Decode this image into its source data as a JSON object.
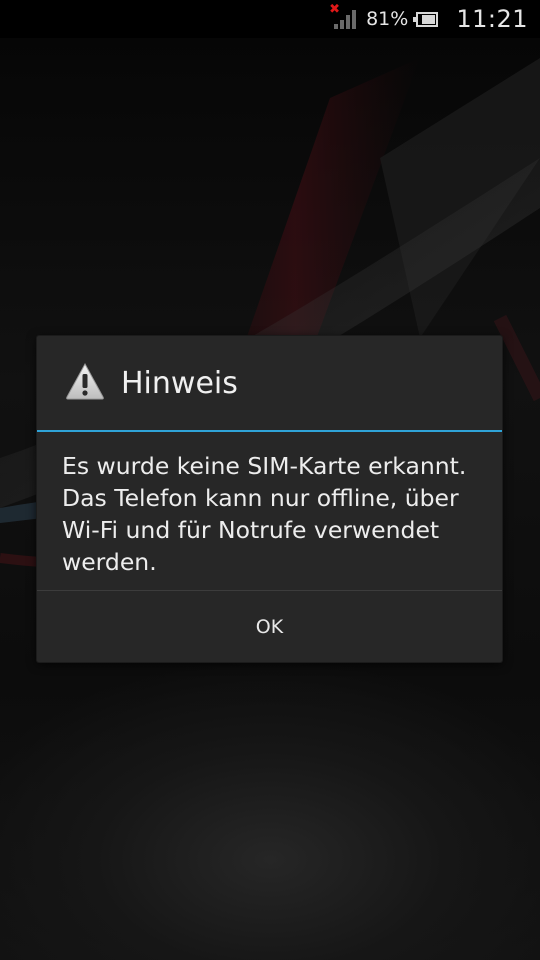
{
  "status_bar": {
    "signal_icon": "signal-no-sim-icon",
    "no_sim_mark": "✖",
    "battery_percent": "81%",
    "battery_level": 0.81,
    "battery_icon": "battery-icon",
    "time": "11:21"
  },
  "dialog": {
    "icon": "warning-icon",
    "title": "Hinweis",
    "message": "Es wurde keine SIM-Karte erkannt.\nDas Telefon kann nur offline, über\nWi-Fi und für Notrufe verwendet\nwerden.",
    "ok_label": "OK"
  },
  "colors": {
    "accent": "#2fa3d8",
    "dialog_background": "#272727",
    "no_sim_mark": "#e01818"
  }
}
